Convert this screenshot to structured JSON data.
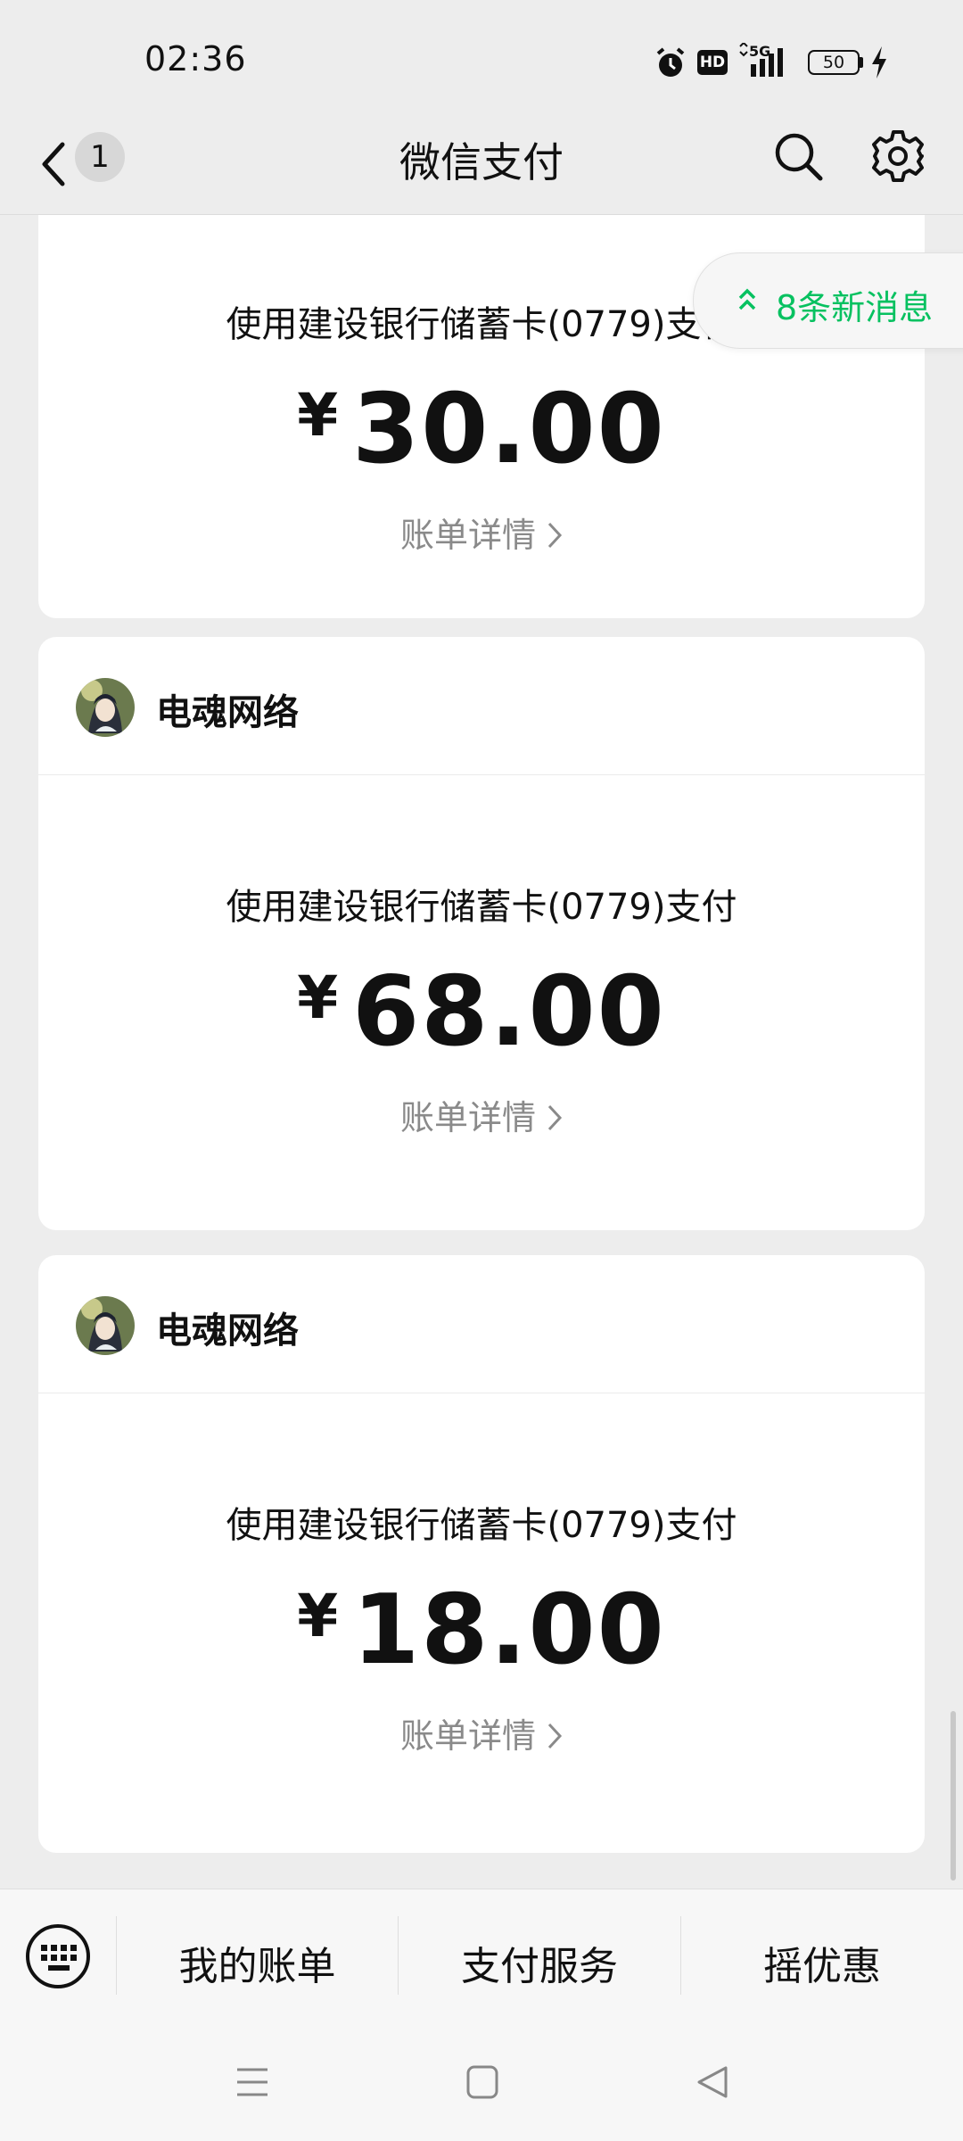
{
  "status_bar": {
    "time": "02:36",
    "network": "5G",
    "hd_label": "HD",
    "battery": "50",
    "icons": [
      "alarm-icon",
      "hd-icon",
      "signal-5g-icon",
      "battery-icon",
      "charging-icon"
    ]
  },
  "header": {
    "title": "微信支付",
    "back_badge": "1"
  },
  "new_messages": "8条新消息",
  "cards": [
    {
      "merchant": "",
      "pay_method": "使用建设银行储蓄卡(0779)支付",
      "currency": "¥",
      "amount": "30.00",
      "detail": "账单详情"
    },
    {
      "merchant": "电魂网络",
      "pay_method": "使用建设银行储蓄卡(0779)支付",
      "currency": "¥",
      "amount": "68.00",
      "detail": "账单详情"
    },
    {
      "merchant": "电魂网络",
      "pay_method": "使用建设银行储蓄卡(0779)支付",
      "currency": "¥",
      "amount": "18.00",
      "detail": "账单详情"
    }
  ],
  "bottom_menu": {
    "items": [
      "我的账单",
      "支付服务",
      "摇优惠"
    ]
  },
  "colors": {
    "accent": "#07c160",
    "background": "#ededed",
    "card": "#ffffff",
    "muted_text": "#8a8a8a"
  }
}
